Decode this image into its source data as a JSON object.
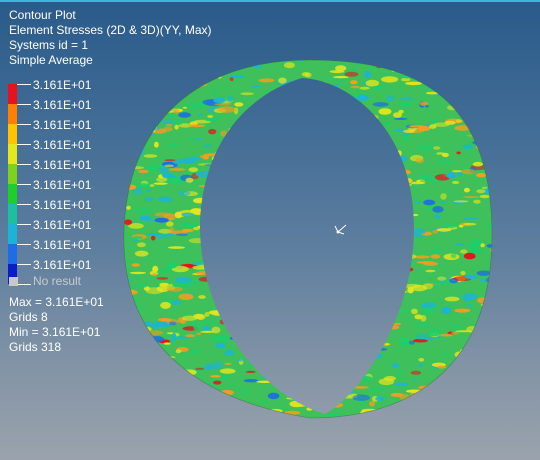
{
  "header": {
    "title": "Contour Plot",
    "result_type": "Element Stresses (2D & 3D)(YY, Max)",
    "system": "Systems id = 1",
    "averaging": "Simple Average"
  },
  "legend": {
    "entries": [
      {
        "value": "3.161E+01",
        "color": "#e8121c"
      },
      {
        "value": "3.161E+01",
        "color": "#ff7f00"
      },
      {
        "value": "3.161E+01",
        "color": "#ffc400"
      },
      {
        "value": "3.161E+01",
        "color": "#e6e61c"
      },
      {
        "value": "3.161E+01",
        "color": "#7fd11c"
      },
      {
        "value": "3.161E+01",
        "color": "#1ccf2a"
      },
      {
        "value": "3.161E+01",
        "color": "#1cbfa0"
      },
      {
        "value": "3.161E+01",
        "color": "#1cb4d6"
      },
      {
        "value": "3.161E+01",
        "color": "#1c6ee6"
      },
      {
        "value": "3.161E+01",
        "color": "#0a1ec8"
      }
    ],
    "no_result_label": "No result"
  },
  "stats": {
    "max": "Max = 3.161E+01",
    "max_grid": "Grids 8",
    "min": "Min = 3.161E+01",
    "min_grid": "Grids 318"
  },
  "colors": {
    "contour_base": "#3ec05a",
    "contour_yellow": "#e6e61c",
    "contour_orange": "#ff9a1c",
    "contour_red": "#e8121c",
    "contour_cyan": "#1cb4d6",
    "contour_blue": "#1c6ee6"
  },
  "icons": {
    "axis_triad": "axis-triad-icon"
  }
}
